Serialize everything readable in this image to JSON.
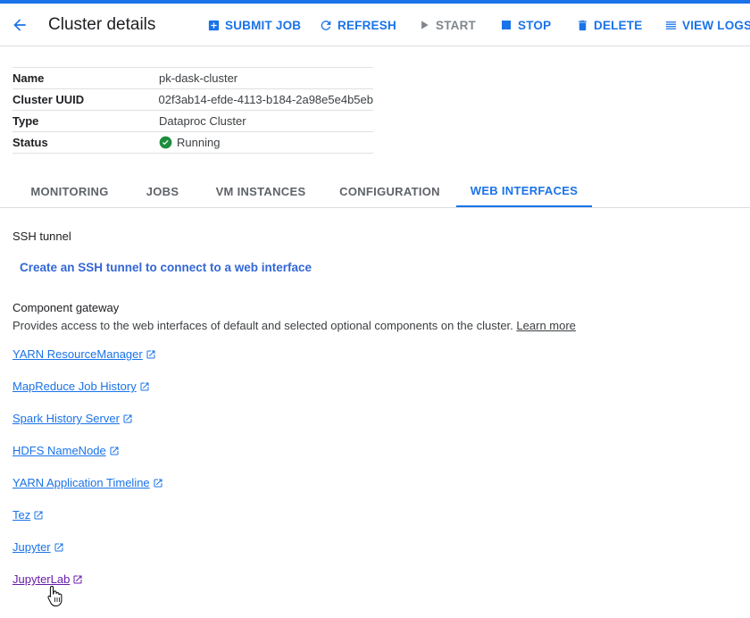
{
  "header": {
    "title": "Cluster details",
    "toolbar": {
      "submit_job": "SUBMIT JOB",
      "refresh": "REFRESH",
      "start": "START",
      "stop": "STOP",
      "delete": "DELETE",
      "view_logs": "VIEW LOGS"
    }
  },
  "details": {
    "rows": [
      {
        "key": "Name",
        "value": "pk-dask-cluster"
      },
      {
        "key": "Cluster UUID",
        "value": "02f3ab14-efde-4113-b184-2a98e5e4b5eb"
      },
      {
        "key": "Type",
        "value": "Dataproc Cluster"
      },
      {
        "key": "Status",
        "value": "Running"
      }
    ]
  },
  "tabs": [
    {
      "label": "MONITORING"
    },
    {
      "label": "JOBS"
    },
    {
      "label": "VM INSTANCES"
    },
    {
      "label": "CONFIGURATION"
    },
    {
      "label": "WEB INTERFACES"
    }
  ],
  "ssh": {
    "heading": "SSH tunnel",
    "link": "Create an SSH tunnel to connect to a web interface"
  },
  "gateway": {
    "heading": "Component gateway",
    "description": "Provides access to the web interfaces of default and selected optional components on the cluster.",
    "learn_more": "Learn more",
    "links": [
      {
        "label": "YARN ResourceManager"
      },
      {
        "label": "MapReduce Job History"
      },
      {
        "label": "Spark History Server"
      },
      {
        "label": "HDFS NameNode"
      },
      {
        "label": "YARN Application Timeline"
      },
      {
        "label": "Tez"
      },
      {
        "label": "Jupyter"
      },
      {
        "label": "JupyterLab"
      }
    ]
  },
  "colors": {
    "accent": "#1a73e8",
    "visited_link": "#681da8",
    "success": "#1e8e3e"
  }
}
